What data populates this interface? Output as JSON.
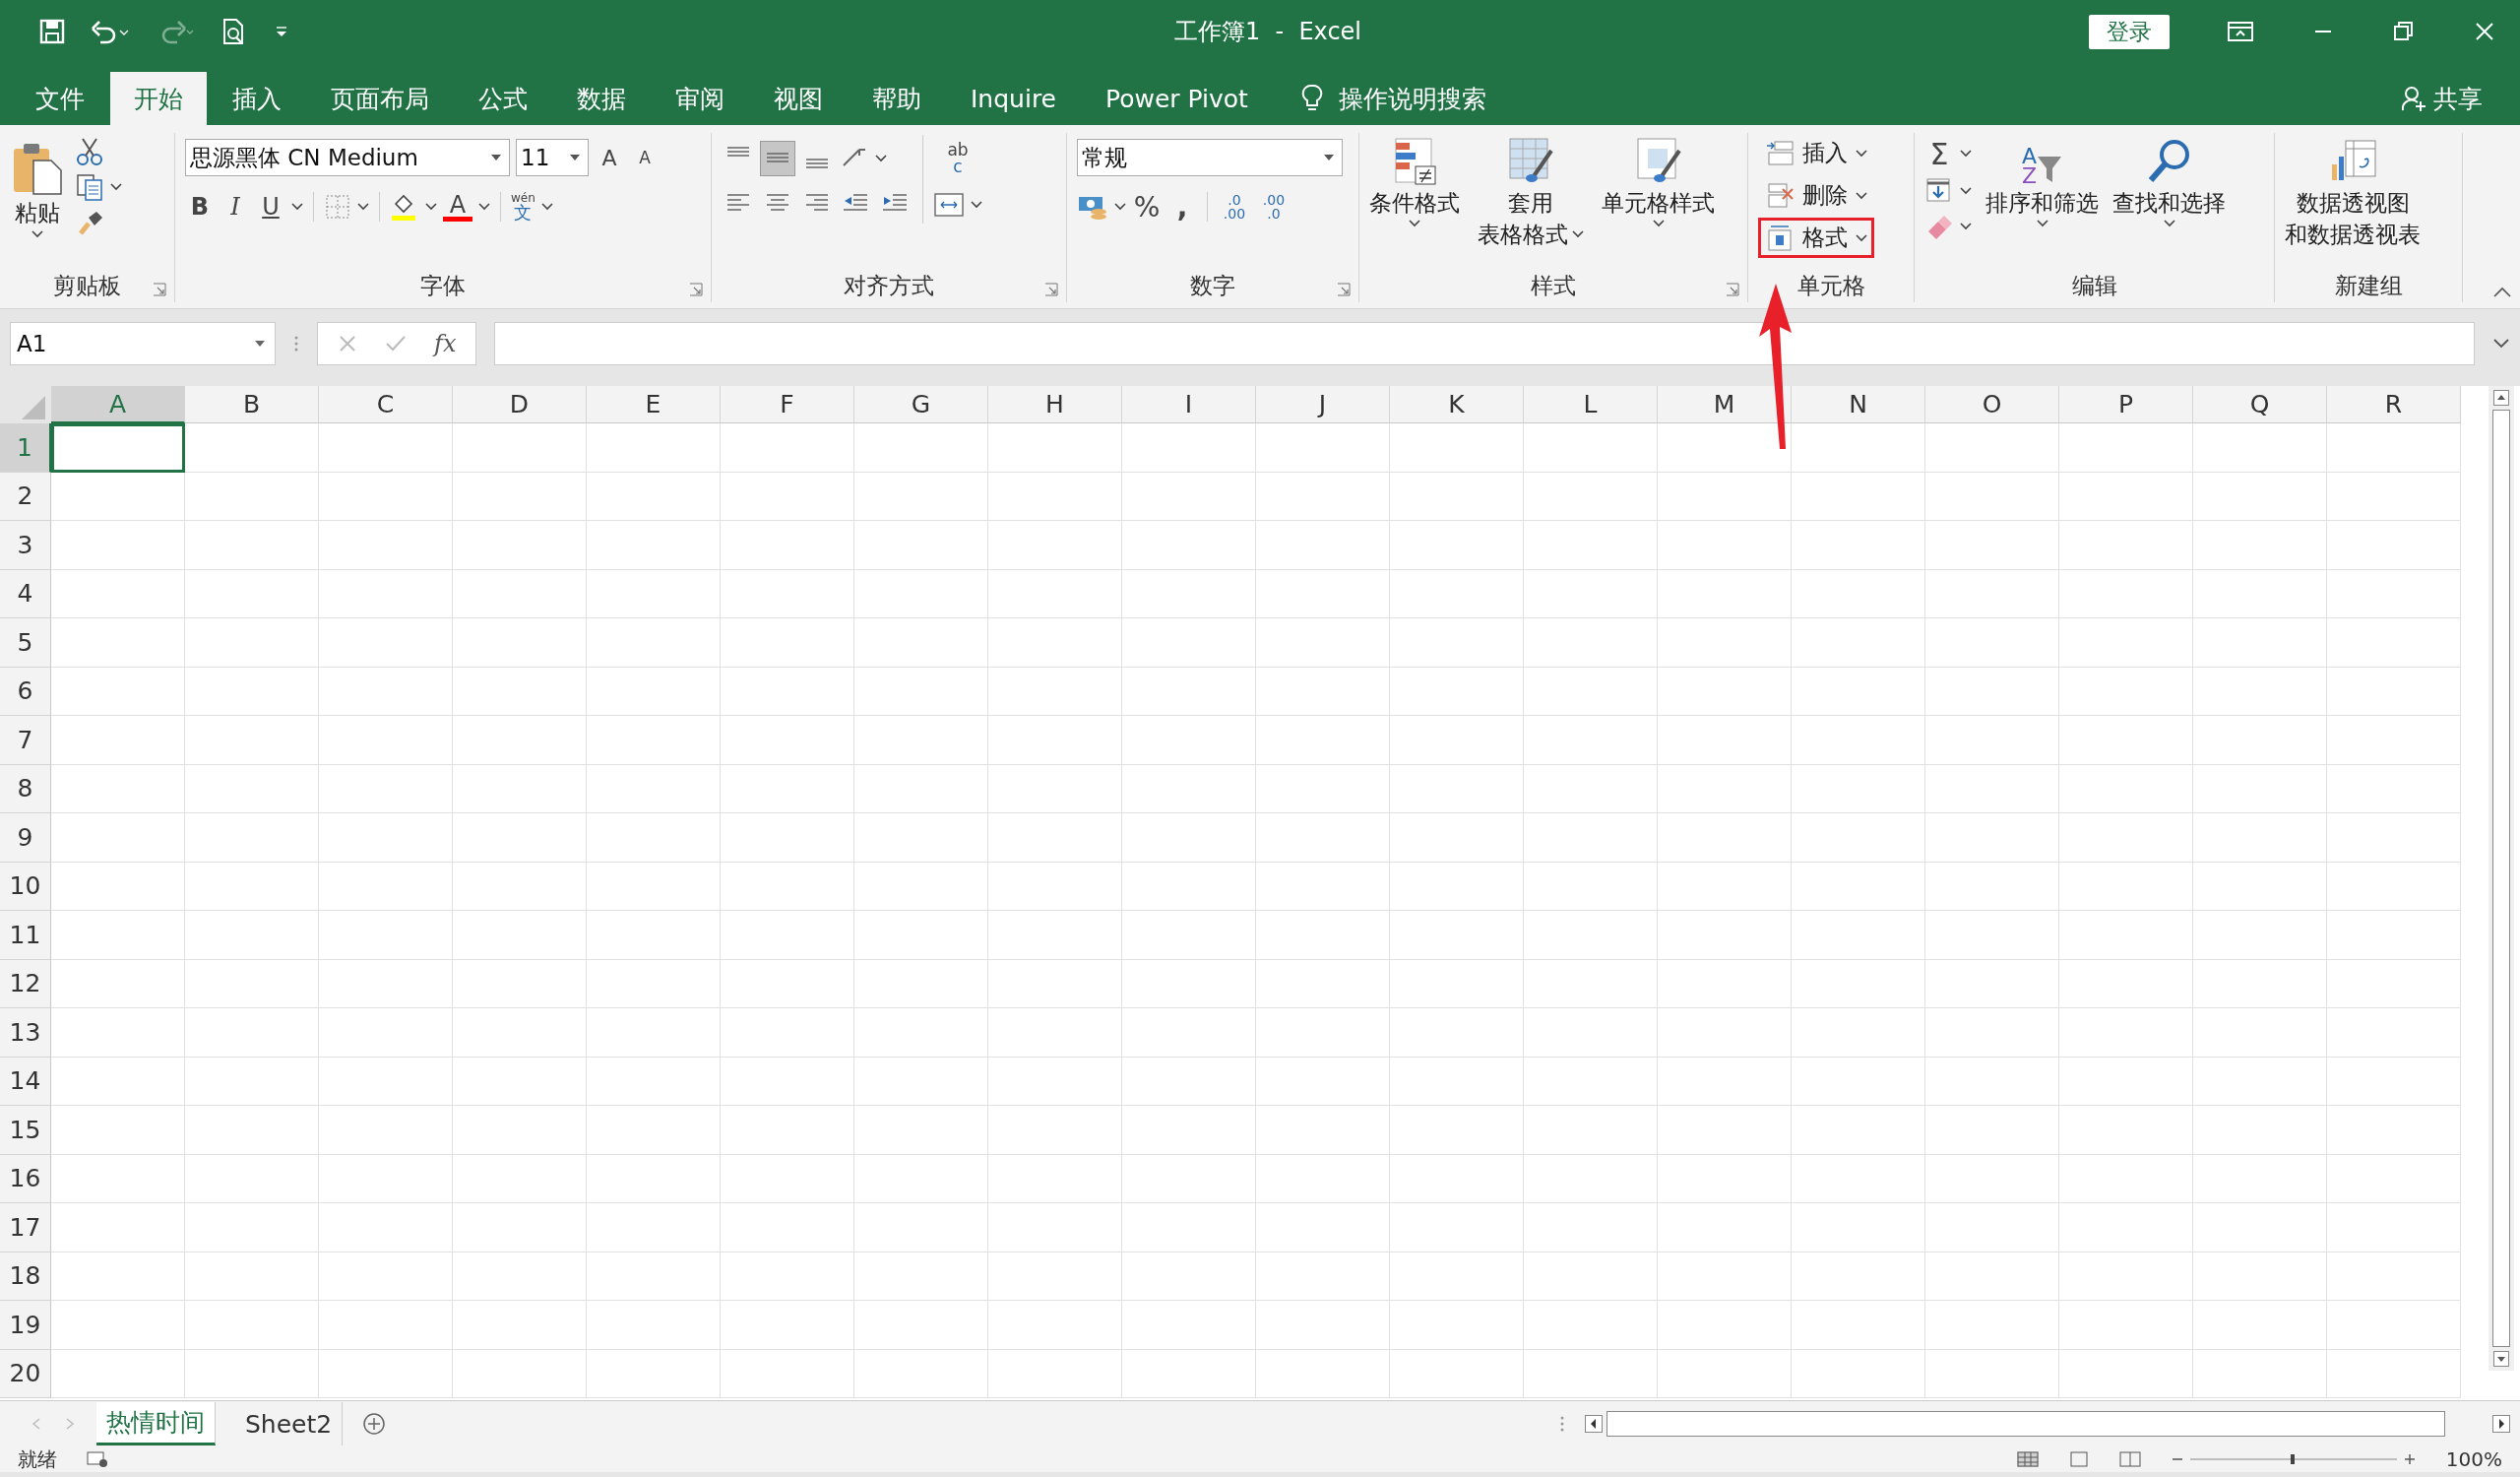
{
  "title_bar": {
    "title": "工作簿1  -  Excel",
    "login_button": "登录"
  },
  "tabs": [
    {
      "label": "文件",
      "selected": false
    },
    {
      "label": "开始",
      "selected": true
    },
    {
      "label": "插入",
      "selected": false
    },
    {
      "label": "页面布局",
      "selected": false
    },
    {
      "label": "公式",
      "selected": false
    },
    {
      "label": "数据",
      "selected": false
    },
    {
      "label": "审阅",
      "selected": false
    },
    {
      "label": "视图",
      "selected": false
    },
    {
      "label": "帮助",
      "selected": false
    },
    {
      "label": "Inquire",
      "selected": false
    },
    {
      "label": "Power Pivot",
      "selected": false
    }
  ],
  "tell_me": "操作说明搜索",
  "share": "共享",
  "ribbon": {
    "clipboard": {
      "label": "剪贴板",
      "paste": "粘贴"
    },
    "font": {
      "label": "字体",
      "font_name": "思源黑体 CN Medium",
      "font_size": "11",
      "grow": "A",
      "shrink": "A",
      "bold": "B",
      "italic": "I",
      "underline": "U",
      "font_color": "A",
      "phonetic": [
        "wén",
        "文"
      ]
    },
    "alignment": {
      "label": "对齐方式",
      "vertical_aligns": [
        {
          "selected": false
        },
        {
          "selected": true
        },
        {
          "selected": false
        }
      ],
      "wrap_text": [
        "ab",
        "c"
      ]
    },
    "number": {
      "label": "数字",
      "format": "常规",
      "percent": "%",
      "comma": ",",
      "increase_decimal": [
        ".0",
        ".00"
      ],
      "decrease_decimal": [
        ".00",
        ".0"
      ]
    },
    "styles": {
      "label": "样式",
      "buttons": [
        {
          "kind": "conditional",
          "lines": [
            "条件格式"
          ]
        },
        {
          "kind": "table",
          "lines": [
            "套用",
            "表格格式"
          ]
        },
        {
          "kind": "cellstyle",
          "lines": [
            "单元格样式"
          ]
        }
      ]
    },
    "cells": {
      "label": "单元格",
      "items": [
        {
          "kind": "insert",
          "label": "插入",
          "highlighted": false
        },
        {
          "kind": "delete",
          "label": "删除",
          "highlighted": false
        },
        {
          "kind": "format",
          "label": "格式",
          "highlighted": true
        }
      ]
    },
    "editing": {
      "label": "编辑",
      "sum": "Σ",
      "sort_letters": [
        "A",
        "Z"
      ],
      "sort": "排序和筛选",
      "find": "查找和选择"
    },
    "new_group": {
      "label": "新建组",
      "pivot": [
        "数据透视图",
        "和数据透视表"
      ]
    }
  },
  "formula_bar": {
    "name_box": "A1",
    "fx": "fx"
  },
  "sheet": {
    "columns": [
      {
        "label": "A",
        "selected": true
      },
      {
        "label": "B",
        "selected": false
      },
      {
        "label": "C",
        "selected": false
      },
      {
        "label": "D",
        "selected": false
      },
      {
        "label": "E",
        "selected": false
      },
      {
        "label": "F",
        "selected": false
      },
      {
        "label": "G",
        "selected": false
      },
      {
        "label": "H",
        "selected": false
      },
      {
        "label": "I",
        "selected": false
      },
      {
        "label": "J",
        "selected": false
      },
      {
        "label": "K",
        "selected": false
      },
      {
        "label": "L",
        "selected": false
      },
      {
        "label": "M",
        "selected": false
      },
      {
        "label": "N",
        "selected": false
      },
      {
        "label": "O",
        "selected": false
      },
      {
        "label": "P",
        "selected": false
      },
      {
        "label": "Q",
        "selected": false
      },
      {
        "label": "R",
        "selected": false
      }
    ],
    "rows": [
      {
        "label": "1",
        "selected": true
      },
      {
        "label": "2",
        "selected": false
      },
      {
        "label": "3",
        "selected": false
      },
      {
        "label": "4",
        "selected": false
      },
      {
        "label": "5",
        "selected": false
      },
      {
        "label": "6",
        "selected": false
      },
      {
        "label": "7",
        "selected": false
      },
      {
        "label": "8",
        "selected": false
      },
      {
        "label": "9",
        "selected": false
      },
      {
        "label": "10",
        "selected": false
      },
      {
        "label": "11",
        "selected": false
      },
      {
        "label": "12",
        "selected": false
      },
      {
        "label": "13",
        "selected": false
      },
      {
        "label": "14",
        "selected": false
      },
      {
        "label": "15",
        "selected": false
      },
      {
        "label": "16",
        "selected": false
      },
      {
        "label": "17",
        "selected": false
      },
      {
        "label": "18",
        "selected": false
      },
      {
        "label": "19",
        "selected": false
      },
      {
        "label": "20",
        "selected": false
      }
    ]
  },
  "sheet_tabs": [
    {
      "label": "热情时间",
      "selected": true
    },
    {
      "label": "Sheet2",
      "selected": false
    }
  ],
  "status_bar": {
    "status": "就绪",
    "zoom": "100%"
  },
  "annotations": [
    {
      "kind": "arrow"
    }
  ]
}
